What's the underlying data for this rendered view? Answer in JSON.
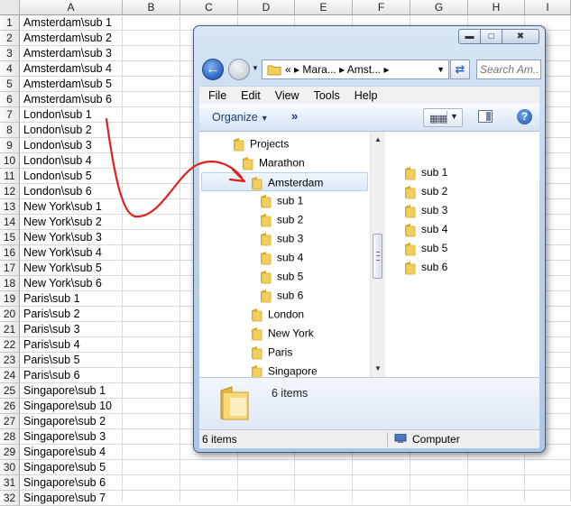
{
  "sheet": {
    "columns": [
      "A",
      "B",
      "C",
      "D",
      "E",
      "F",
      "G",
      "H",
      "I"
    ],
    "rows": [
      {
        "n": "1",
        "a": "Amsterdam\\sub 1"
      },
      {
        "n": "2",
        "a": "Amsterdam\\sub 2"
      },
      {
        "n": "3",
        "a": "Amsterdam\\sub 3"
      },
      {
        "n": "4",
        "a": "Amsterdam\\sub 4"
      },
      {
        "n": "5",
        "a": "Amsterdam\\sub 5"
      },
      {
        "n": "6",
        "a": "Amsterdam\\sub 6"
      },
      {
        "n": "7",
        "a": "London\\sub 1"
      },
      {
        "n": "8",
        "a": "London\\sub 2"
      },
      {
        "n": "9",
        "a": "London\\sub 3"
      },
      {
        "n": "10",
        "a": "London\\sub 4"
      },
      {
        "n": "11",
        "a": "London\\sub 5"
      },
      {
        "n": "12",
        "a": "London\\sub 6"
      },
      {
        "n": "13",
        "a": "New York\\sub 1"
      },
      {
        "n": "14",
        "a": "New York\\sub 2"
      },
      {
        "n": "15",
        "a": "New York\\sub 3"
      },
      {
        "n": "16",
        "a": "New York\\sub 4"
      },
      {
        "n": "17",
        "a": "New York\\sub 5"
      },
      {
        "n": "18",
        "a": "New York\\sub 6"
      },
      {
        "n": "19",
        "a": "Paris\\sub 1"
      },
      {
        "n": "20",
        "a": "Paris\\sub 2"
      },
      {
        "n": "21",
        "a": "Paris\\sub 3"
      },
      {
        "n": "22",
        "a": "Paris\\sub 4"
      },
      {
        "n": "23",
        "a": "Paris\\sub 5"
      },
      {
        "n": "24",
        "a": "Paris\\sub 6"
      },
      {
        "n": "25",
        "a": "Singapore\\sub 1"
      },
      {
        "n": "26",
        "a": "Singapore\\sub 10"
      },
      {
        "n": "27",
        "a": "Singapore\\sub 2"
      },
      {
        "n": "28",
        "a": "Singapore\\sub 3"
      },
      {
        "n": "29",
        "a": "Singapore\\sub 4"
      },
      {
        "n": "30",
        "a": "Singapore\\sub 5"
      },
      {
        "n": "31",
        "a": "Singapore\\sub 6"
      },
      {
        "n": "32",
        "a": "Singapore\\sub 7"
      }
    ]
  },
  "annotation": {
    "arrow_color": "#e02020"
  },
  "explorer": {
    "caption_buttons": {
      "minimize": "minimize-icon",
      "maximize": "maximize-icon",
      "close": "close-icon"
    },
    "address": {
      "prefix": "«",
      "crumbs": [
        "Mara...",
        "Amst..."
      ],
      "separator": "▸"
    },
    "search_placeholder": "Search Am...",
    "menu": [
      "File",
      "Edit",
      "View",
      "Tools",
      "Help"
    ],
    "toolbar": {
      "organize": "Organize",
      "more": "»"
    },
    "tree": [
      {
        "label": "Projects",
        "level": 0,
        "selected": false
      },
      {
        "label": "Marathon",
        "level": 1,
        "selected": false
      },
      {
        "label": "Amsterdam",
        "level": 2,
        "selected": true
      },
      {
        "label": "sub 1",
        "level": 3,
        "selected": false
      },
      {
        "label": "sub 2",
        "level": 3,
        "selected": false
      },
      {
        "label": "sub 3",
        "level": 3,
        "selected": false
      },
      {
        "label": "sub 4",
        "level": 3,
        "selected": false
      },
      {
        "label": "sub 5",
        "level": 3,
        "selected": false
      },
      {
        "label": "sub 6",
        "level": 3,
        "selected": false
      },
      {
        "label": "London",
        "level": 2,
        "selected": false
      },
      {
        "label": "New York",
        "level": 2,
        "selected": false
      },
      {
        "label": "Paris",
        "level": 2,
        "selected": false
      },
      {
        "label": "Singapore",
        "level": 2,
        "selected": false
      }
    ],
    "files": [
      "sub 1",
      "sub 2",
      "sub 3",
      "sub 4",
      "sub 5",
      "sub 6"
    ],
    "details": {
      "count": "6 items"
    },
    "status": {
      "left": "6 items",
      "right": "Computer"
    },
    "colors": {
      "folder": "#f2cf5a",
      "folder_dark": "#d9a92c",
      "selection": "#dbe8f8"
    }
  }
}
